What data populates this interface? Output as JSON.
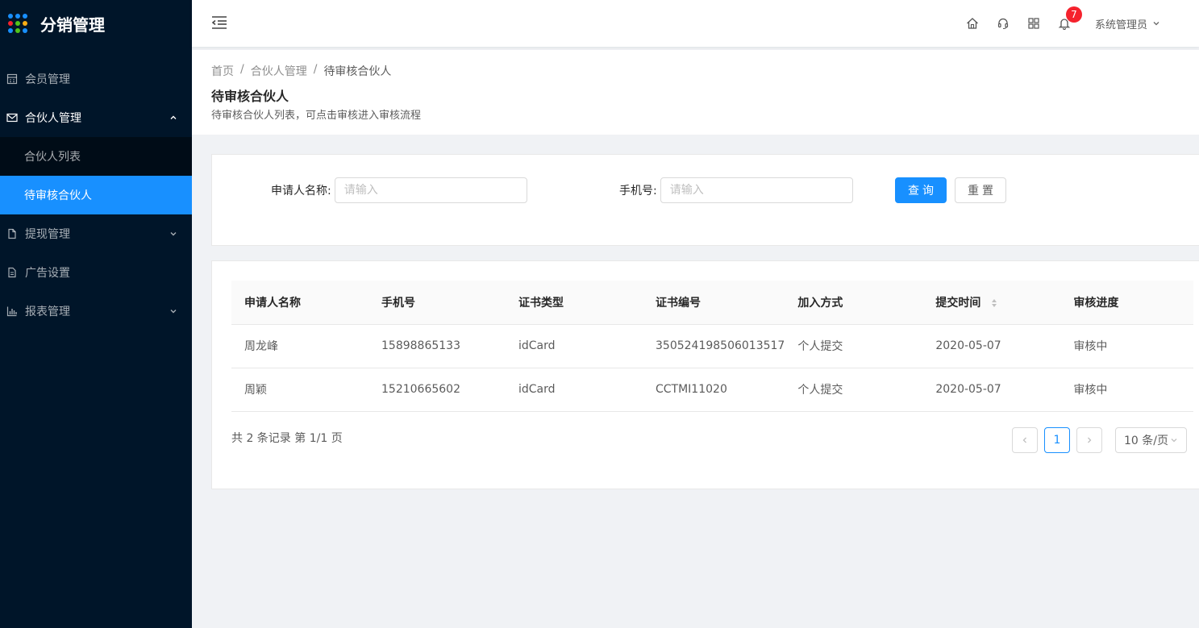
{
  "brand": {
    "title": "分销管理",
    "dot_colors": [
      "#1890ff",
      "#1890ff",
      "#1890ff",
      "#f5222d",
      "#52c41a",
      "#faad14",
      "#1890ff",
      "#52c41a",
      "#1890ff"
    ]
  },
  "sidebar": {
    "items": [
      {
        "label": "会员管理",
        "icon": "calculator-icon"
      },
      {
        "label": "合伙人管理",
        "icon": "mail-icon",
        "open": true,
        "children": [
          {
            "label": "合伙人列表"
          },
          {
            "label": "待审核合伙人",
            "active": true
          }
        ]
      },
      {
        "label": "提现管理",
        "icon": "file-icon"
      },
      {
        "label": "广告设置",
        "icon": "file-text-icon"
      },
      {
        "label": "报表管理",
        "icon": "bar-chart-icon"
      }
    ]
  },
  "header": {
    "notification_count": "7",
    "user_name": "系统管理员"
  },
  "breadcrumb": [
    "首页",
    "合伙人管理",
    "待审核合伙人"
  ],
  "page": {
    "title": "待审核合伙人",
    "description": "待审核合伙人列表，可点击审核进入审核流程"
  },
  "search": {
    "applicant_label": "申请人名称:",
    "applicant_placeholder": "请输入",
    "phone_label": "手机号:",
    "phone_placeholder": "请输入",
    "query_label": "查询",
    "reset_label": "重置"
  },
  "table": {
    "columns": [
      "申请人名称",
      "手机号",
      "证书类型",
      "证书编号",
      "加入方式",
      "提交时间",
      "审核进度"
    ],
    "rows": [
      [
        "周龙峰",
        "15898865133",
        "idCard",
        "350524198506013517",
        "个人提交",
        "2020-05-07",
        "审核中"
      ],
      [
        "周颖",
        "15210665602",
        "idCard",
        "CCTMI11020",
        "个人提交",
        "2020-05-07",
        "审核中"
      ]
    ]
  },
  "pagination": {
    "total_text": "共 2 条记录 第 1/1 页",
    "current_page": "1",
    "page_size": "10 条/页"
  },
  "colors": {
    "primary": "#1890ff",
    "sidebar_bg": "#001529",
    "submenu_bg": "#000c17",
    "badge": "#f5222d"
  }
}
